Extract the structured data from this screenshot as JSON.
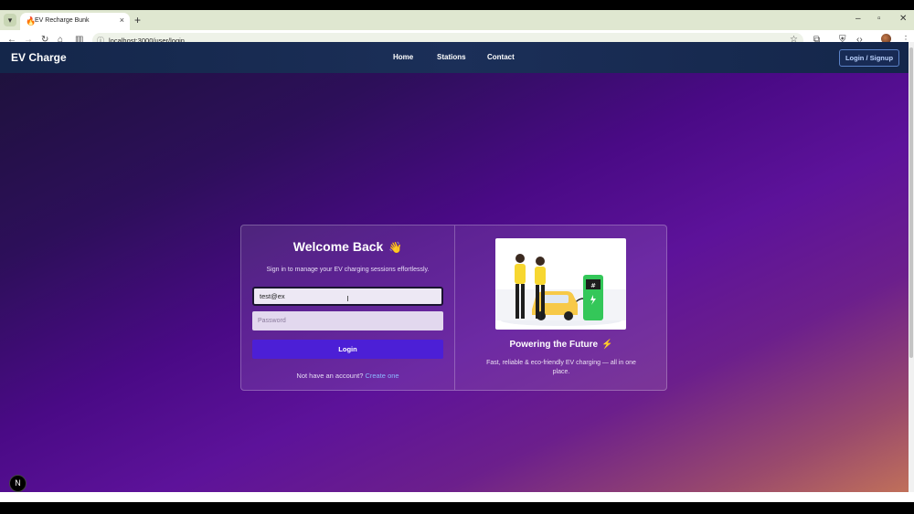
{
  "browser": {
    "tab_title": "EV Recharge Bunk",
    "url": "localhost:3000/user/login",
    "tab_favicon_icon": "flame-icon"
  },
  "nav": {
    "brand": "EV Charge",
    "links": [
      "Home",
      "Stations",
      "Contact"
    ],
    "login_button": "Login / Signup"
  },
  "login": {
    "title": "Welcome Back",
    "wave": "👋",
    "subtitle": "Sign in to manage your EV charging sessions effortlessly.",
    "email_value": "test@ex",
    "password_placeholder": "Password",
    "submit_label": "Login",
    "signup_prompt": "Not have an account?",
    "signup_link": "Create one"
  },
  "promo": {
    "title": "Powering the Future",
    "bolt": "⚡",
    "description": "Fast, reliable & eco-friendly EV charging — all in one place."
  },
  "badge": "N",
  "colors": {
    "accent": "#4c1fd6",
    "nav_bg": "#14264a",
    "link": "#8cb8ff"
  }
}
